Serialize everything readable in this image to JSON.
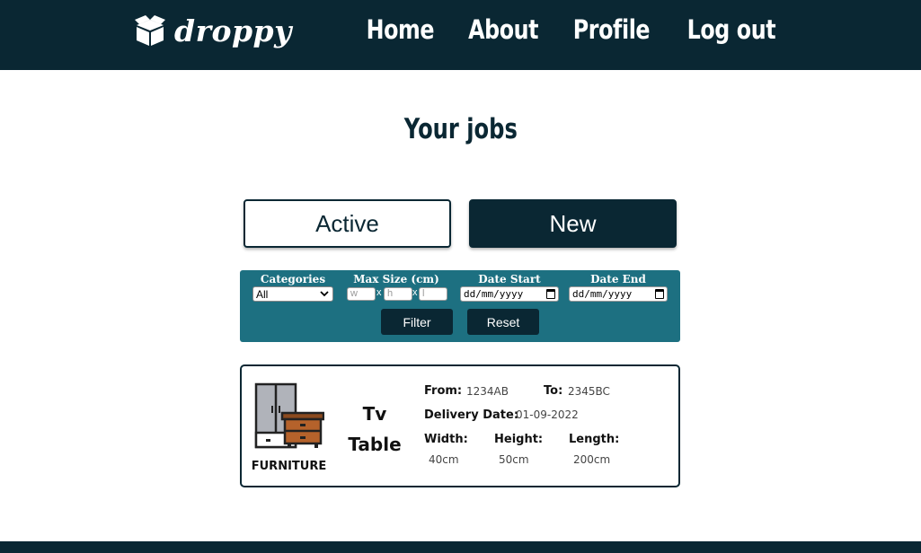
{
  "brand": {
    "name": "droppy",
    "logo_icon": "open-box-icon"
  },
  "nav": {
    "items": [
      "Home",
      "About",
      "Profile",
      "Log out"
    ]
  },
  "page": {
    "title": "Your jobs"
  },
  "tabs": {
    "active_label": "Active",
    "new_label": "New"
  },
  "filters": {
    "categories_label": "Categories",
    "categories_selected": "All",
    "max_size_label": "Max Size (cm)",
    "width_placeholder": "w",
    "height_placeholder": "h",
    "length_placeholder": "l",
    "separator": "x",
    "date_start_label": "Date Start",
    "date_end_label": "Date End",
    "date_placeholder": "dd/mm/yyyy",
    "filter_button": "Filter",
    "reset_button": "Reset"
  },
  "jobs": [
    {
      "category": "FURNITURE",
      "category_icon": "furniture-icon",
      "title_line1": "Tv",
      "title_line2": "Table",
      "from_label": "From:",
      "from": "1234AB",
      "to_label": "To:",
      "to": "2345BC",
      "delivery_label": "Delivery Date:",
      "delivery_date": "01-09-2022",
      "width_label": "Width:",
      "width": "40cm",
      "height_label": "Height:",
      "height": "50cm",
      "length_label": "Length:",
      "length": "200cm"
    }
  ],
  "colors": {
    "primary": "#0a2733",
    "filter_bg": "#1d7081",
    "background": "#ffffff"
  }
}
